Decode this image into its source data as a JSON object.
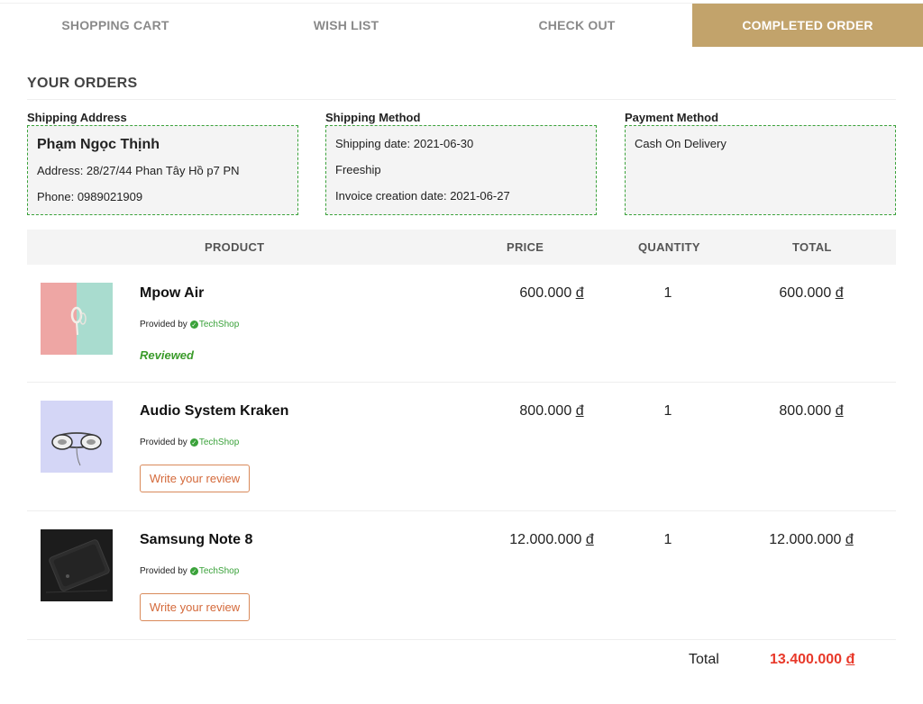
{
  "tabs": [
    {
      "label": "SHOPPING CART"
    },
    {
      "label": "WISH LIST"
    },
    {
      "label": "CHECK OUT"
    },
    {
      "label": "COMPLETED ORDER"
    }
  ],
  "active_tab": "COMPLETED ORDER",
  "accent_color": "#c2a36b",
  "section_title": "YOUR ORDERS",
  "shipping_address": {
    "label": "Shipping Address",
    "name": "Phạm Ngọc Thịnh",
    "address": "Address: 28/27/44 Phan Tây Hồ p7 PN",
    "phone": "Phone: 0989021909"
  },
  "shipping_method": {
    "label": "Shipping Method",
    "date": "Shipping date: 2021-06-30",
    "method": "Freeship",
    "invoice": "Invoice creation date: 2021-06-27"
  },
  "payment_method": {
    "label": "Payment Method",
    "value": "Cash On Delivery"
  },
  "table_headers": {
    "product": "PRODUCT",
    "price": "PRICE",
    "quantity": "QUANTITY",
    "total": "TOTAL"
  },
  "currency_symbol": "đ",
  "items": [
    {
      "name": "Mpow Air",
      "provided_by": "Provided by",
      "shop": "TechShop",
      "price": "600.000",
      "quantity": "1",
      "total": "600.000",
      "status": "Reviewed",
      "image": "pink-mint-earbuds"
    },
    {
      "name": "Audio System Kraken",
      "provided_by": "Provided by",
      "shop": "TechShop",
      "price": "800.000",
      "quantity": "1",
      "total": "800.000",
      "action": "Write your review",
      "image": "lavender-headphones"
    },
    {
      "name": "Samsung Note 8",
      "provided_by": "Provided by",
      "shop": "TechShop",
      "price": "12.000.000",
      "quantity": "1",
      "total": "12.000.000",
      "action": "Write your review",
      "image": "dark-phone"
    }
  ],
  "order_total": {
    "label": "Total",
    "value": "13.400.000"
  },
  "colors": {
    "total": "#e8392a",
    "verified": "#3aa23a",
    "review_button": "#d4693a"
  }
}
